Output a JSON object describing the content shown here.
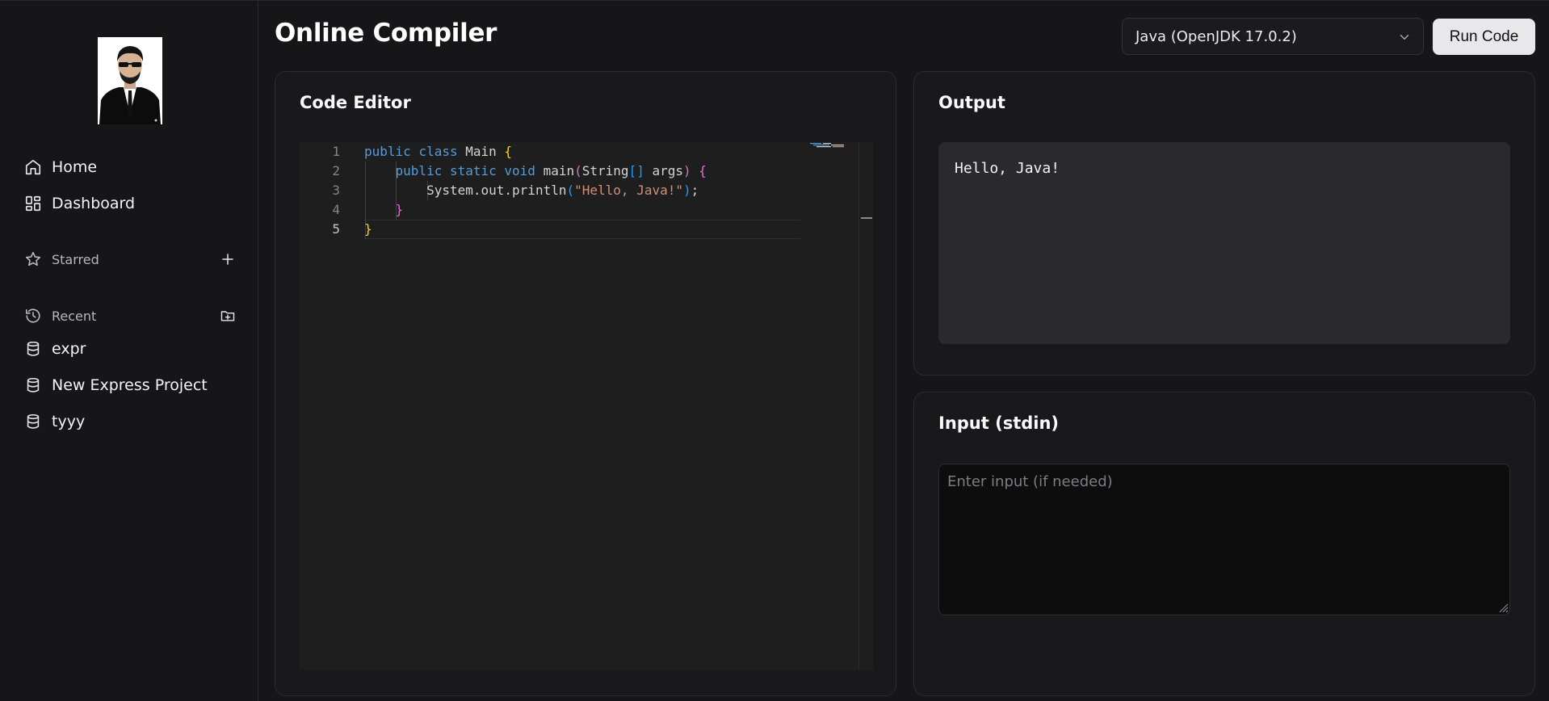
{
  "sidebar": {
    "nav": [
      {
        "label": "Home",
        "icon": "home-icon"
      },
      {
        "label": "Dashboard",
        "icon": "dashboard-icon"
      }
    ],
    "starred": {
      "label": "Starred",
      "icon": "star-icon",
      "action_icon": "plus-icon"
    },
    "recent": {
      "label": "Recent",
      "icon": "history-icon",
      "action_icon": "folder-plus-icon",
      "items": [
        {
          "label": "expr",
          "icon": "database-icon"
        },
        {
          "label": "New Express Project",
          "icon": "database-icon"
        },
        {
          "label": "tyyy",
          "icon": "database-icon"
        }
      ]
    }
  },
  "header": {
    "title": "Online Compiler",
    "language_selected": "Java (OpenJDK 17.0.2)",
    "run_label": "Run Code"
  },
  "editor": {
    "title": "Code Editor",
    "line_numbers": [
      "1",
      "2",
      "3",
      "4",
      "5"
    ],
    "lines": [
      "public class Main {",
      "    public static void main(String[] args) {",
      "        System.out.println(\"Hello, Java!\");",
      "    }",
      "}"
    ]
  },
  "output": {
    "title": "Output",
    "text": "Hello, Java!"
  },
  "stdin": {
    "title": "Input (stdin)",
    "placeholder": "Enter input (if needed)",
    "value": ""
  },
  "colors": {
    "background": "#161618",
    "card": "#19191b",
    "run_button": "#e8e8ea",
    "keyword": "#569cd6",
    "string": "#ce9178"
  }
}
